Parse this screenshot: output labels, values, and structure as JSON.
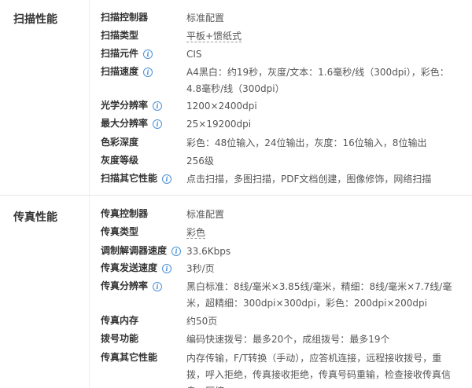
{
  "sections": [
    {
      "title": "扫描性能",
      "rows": [
        {
          "label": "扫描控制器",
          "value": "标准配置"
        },
        {
          "label": "扫描类型",
          "value": "平板+馈纸式"
        },
        {
          "label": "扫描元件",
          "value": "CIS"
        },
        {
          "label": "扫描速度",
          "value": "A4黑白：约19秒，灰度/文本：1.6毫秒/线（300dpi），彩色：4.8毫秒/线（300dpi）"
        },
        {
          "label": "光学分辨率",
          "value": "1200×2400dpi"
        },
        {
          "label": "最大分辨率",
          "value": "25×19200dpi"
        },
        {
          "label": "色彩深度",
          "value": "彩色：48位输入，24位输出，灰度：16位输入，8位输出"
        },
        {
          "label": "灰度等级",
          "value": "256级"
        },
        {
          "label": "扫描其它性能",
          "value": "点击扫描，多图扫描，PDF文档创建，图像修饰，网络扫描"
        }
      ]
    },
    {
      "title": "传真性能",
      "rows": [
        {
          "label": "传真控制器",
          "value": "标准配置"
        },
        {
          "label": "传真类型",
          "value": "彩色"
        },
        {
          "label": "调制解调器速度",
          "value": "33.6Kbps"
        },
        {
          "label": "传真发送速度",
          "value": "3秒/页"
        },
        {
          "label": "传真分辨率",
          "value": "黑白标准：8线/毫米×3.85线/毫米，精细：8线/毫米×7.7线/毫米，超精细：300dpi×300dpi，彩色：200dpi×200dpi"
        },
        {
          "label": "传真内存",
          "value": "约50页"
        },
        {
          "label": "拨号功能",
          "value": "编码快速拨号：最多20个，成组拨号：最多19个"
        },
        {
          "label": "传真其它性能",
          "value": "内存传输，F/T转换（手动），应答机连接，远程接收拨号，重拨，呼入拒绝，传真接收拒绝，传真号码重输，检查接收传真信息，压缩"
        }
      ]
    }
  ]
}
